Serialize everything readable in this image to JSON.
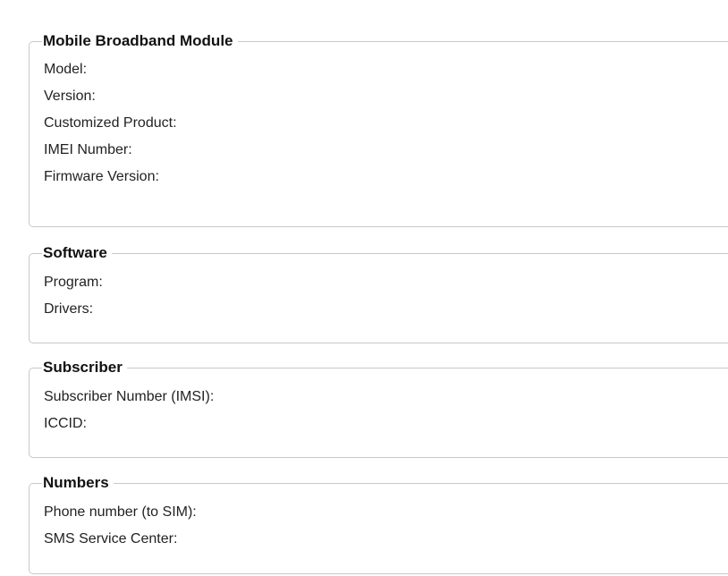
{
  "groups": [
    {
      "title": "Mobile Broadband Module",
      "fields": [
        {
          "label": "Model:"
        },
        {
          "label": "Version:"
        },
        {
          "label": "Customized Product:"
        },
        {
          "label": "IMEI Number:"
        },
        {
          "label": "Firmware Version:"
        }
      ]
    },
    {
      "title": "Software",
      "fields": [
        {
          "label": "Program:"
        },
        {
          "label": "Drivers:"
        }
      ]
    },
    {
      "title": "Subscriber",
      "fields": [
        {
          "label": "Subscriber Number (IMSI):"
        },
        {
          "label": "ICCID:"
        }
      ]
    },
    {
      "title": "Numbers",
      "fields": [
        {
          "label": "Phone number (to SIM):"
        },
        {
          "label": "SMS Service Center:"
        }
      ]
    }
  ]
}
